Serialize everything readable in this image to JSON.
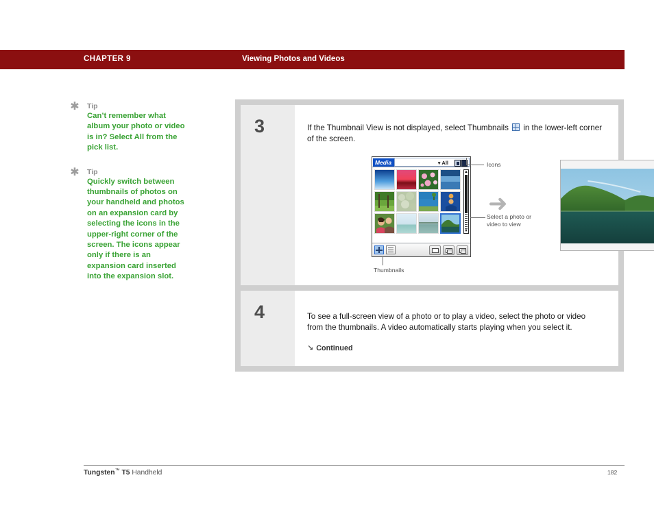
{
  "header": {
    "chapter": "CHAPTER 9",
    "title": "Viewing Photos and Videos",
    "bar_color": "#8b0f10"
  },
  "sidebar": {
    "tips": [
      {
        "icon": "asterisk-icon",
        "label": "Tip",
        "body": "Can’t remember what album your photo or video is in? Select All from the pick list."
      },
      {
        "icon": "asterisk-icon",
        "label": "Tip",
        "body": "Quickly switch between thumbnails of photos on your handheld and photos on an expansion card by selecting the icons in the upper-right corner of the screen. The icons appear only if there is an expansion card inserted into the expansion slot."
      }
    ],
    "tip_label_color": "#8f8f8f",
    "tip_body_color": "#3aa335"
  },
  "steps": [
    {
      "number": "3",
      "text_before_icon": "If the Thumbnail View is not displayed, select Thumbnails ",
      "inline_icon": "thumbnail-grid-icon",
      "text_after_icon": " in the lower-left corner of the screen."
    },
    {
      "number": "4",
      "text": "To see a full-screen view of a photo or to play a video, select the photo or video from the thumbnails. A video automatically starts playing when you select it.",
      "continued_label": "Continued",
      "continued_icon": "arrow-down-right-icon"
    }
  ],
  "illustration": {
    "device": {
      "app_title": "Media",
      "pick_list_value": "All",
      "pick_list_caret": "▾",
      "title_icons": [
        "card-icon",
        "handheld-icon"
      ],
      "toolbar": {
        "view_buttons": [
          "thumbnail-view-icon",
          "list-view-icon"
        ],
        "action_buttons": [
          "email-icon",
          "copy-icon",
          "beam-icon"
        ]
      },
      "thumbnails": [
        {
          "name": "blue-sky-photo",
          "selected": false
        },
        {
          "name": "red-sunset-photo",
          "selected": false
        },
        {
          "name": "pink-flowers-photo",
          "selected": false
        },
        {
          "name": "blue-water-photo",
          "selected": false
        },
        {
          "name": "green-forest-photo",
          "selected": false
        },
        {
          "name": "blossom-tree-photo",
          "selected": false
        },
        {
          "name": "coast-beach-photo",
          "selected": false
        },
        {
          "name": "person-blue-photo",
          "selected": false
        },
        {
          "name": "two-people-photo",
          "selected": false
        },
        {
          "name": "pale-sea-photo",
          "selected": false
        },
        {
          "name": "grey-sea-photo",
          "selected": false
        },
        {
          "name": "green-hills-lake-photo",
          "selected": true
        }
      ]
    },
    "callouts": {
      "icons": "Icons",
      "select_photo": "Select a photo or video to view",
      "thumbnails": "Thumbnails"
    },
    "arrow_glyph": "➜",
    "large_photo": "green-hills-lake-photo-large"
  },
  "footer": {
    "product_bold": "Tungsten",
    "product_tm": "™",
    "product_model": " T5 ",
    "product_rest": "Handheld",
    "page_number": "182"
  }
}
